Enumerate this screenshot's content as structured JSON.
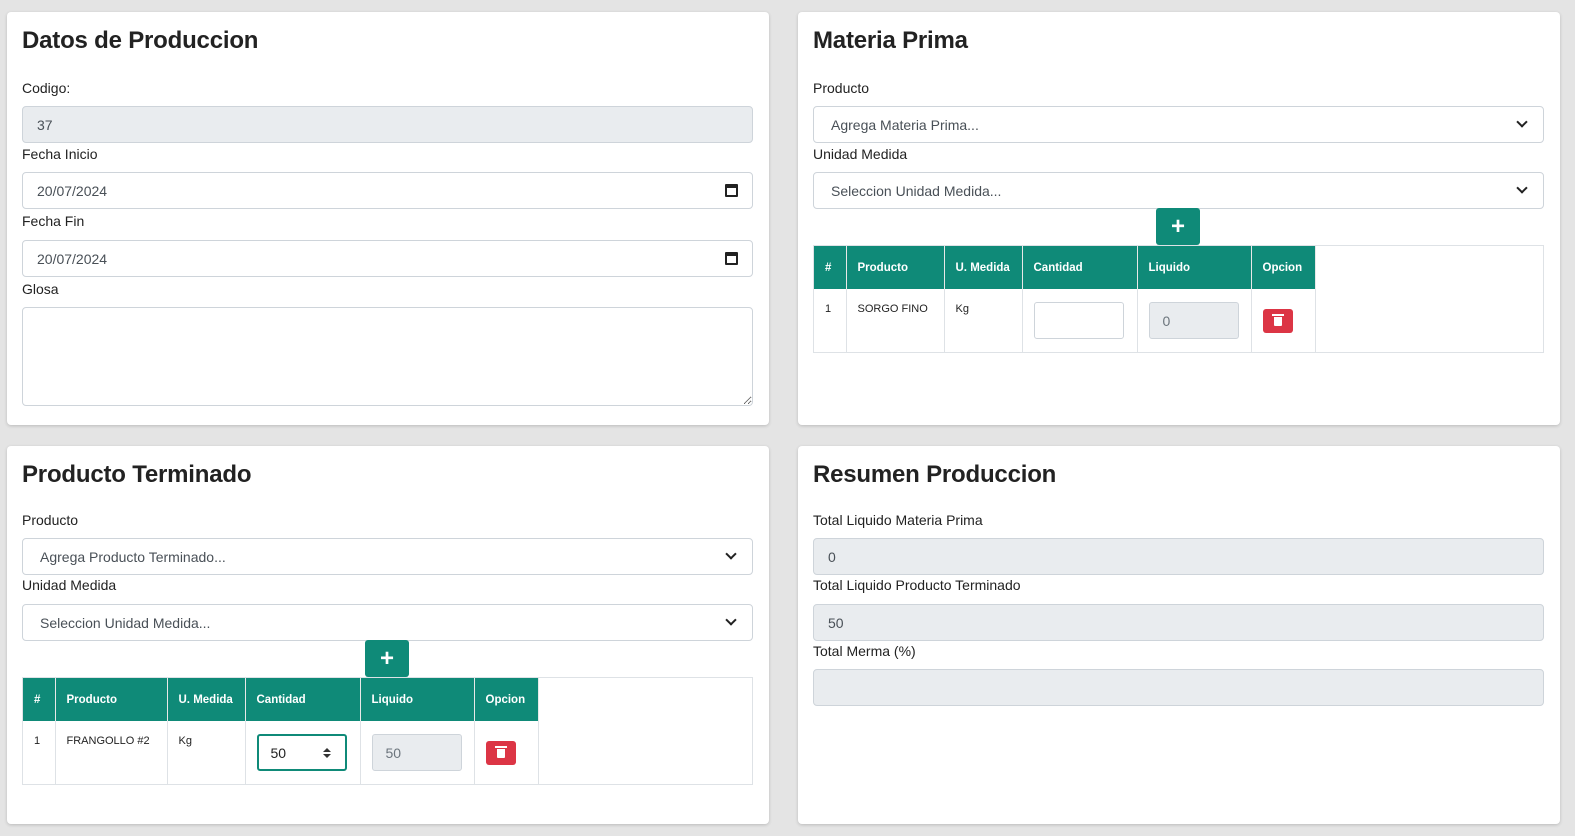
{
  "datos": {
    "title": "Datos de Produccion",
    "codigo_label": "Codigo:",
    "codigo_value": "37",
    "fecha_inicio_label": "Fecha Inicio",
    "fecha_inicio_value": "20/07/2024",
    "fecha_fin_label": "Fecha Fin",
    "fecha_fin_value": "20/07/2024",
    "glosa_label": "Glosa",
    "glosa_value": ""
  },
  "materia_prima": {
    "title": "Materia Prima",
    "producto_label": "Producto",
    "producto_selected": "Agrega Materia Prima...",
    "unidad_label": "Unidad Medida",
    "unidad_selected": "Seleccion Unidad Medida...",
    "add_label": "+",
    "table": {
      "headers": [
        "#",
        "Producto",
        "U. Medida",
        "Cantidad",
        "Liquido",
        "Opcion"
      ],
      "rows": [
        {
          "num": "1",
          "producto": "SORGO FINO",
          "unidad": "Kg",
          "cantidad": "",
          "liquido": "0"
        }
      ]
    }
  },
  "producto_terminado": {
    "title": "Producto Terminado",
    "producto_label": "Producto",
    "producto_selected": "Agrega Producto Terminado...",
    "unidad_label": "Unidad Medida",
    "unidad_selected": "Seleccion Unidad Medida...",
    "add_label": "+",
    "table": {
      "headers": [
        "#",
        "Producto",
        "U. Medida",
        "Cantidad",
        "Liquido",
        "Opcion"
      ],
      "rows": [
        {
          "num": "1",
          "producto": "FRANGOLLO #2",
          "unidad": "Kg",
          "cantidad": "50",
          "liquido": "50"
        }
      ]
    }
  },
  "resumen": {
    "title": "Resumen Produccion",
    "total_mp_label": "Total Liquido Materia Prima",
    "total_mp_value": "0",
    "total_pt_label": "Total Liquido Producto Terminado",
    "total_pt_value": "50",
    "merma_label": "Total Merma (%)",
    "merma_value": ""
  },
  "colors": {
    "accent": "#0f8a78",
    "danger": "#dc3545",
    "readonly_bg": "#e9ecef",
    "page_bg": "#e4e4e4"
  },
  "icons": {
    "calendar": "calendar-icon",
    "dropdown": "chevron-down-icon",
    "delete": "trash-icon",
    "add": "plus-icon"
  }
}
